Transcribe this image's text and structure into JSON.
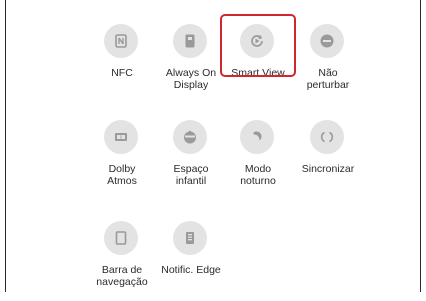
{
  "quick_settings": {
    "rows": [
      [
        {
          "icon": "nfc-icon",
          "label": "NFC"
        },
        {
          "icon": "always-on-display-icon",
          "label": "Always On\nDisplay"
        },
        {
          "icon": "smart-view-icon",
          "label": "Smart View",
          "highlighted": true
        },
        {
          "icon": "do-not-disturb-icon",
          "label": "Não\nperturbar"
        }
      ],
      [
        {
          "icon": "dolby-atmos-icon",
          "label": "Dolby\nAtmos"
        },
        {
          "icon": "kids-space-icon",
          "label": "Espaço\ninfantil"
        },
        {
          "icon": "night-mode-icon",
          "label": "Modo\nnoturno"
        },
        {
          "icon": "sync-icon",
          "label": "Sincronizar"
        }
      ],
      [
        {
          "icon": "navigation-bar-icon",
          "label": "Barra de\nnavegação"
        },
        {
          "icon": "edge-notification-icon",
          "label": "Notific. Edge"
        }
      ]
    ]
  },
  "colors": {
    "icon_circle": "#e3e3e3",
    "icon_glyph": "#9a9a9a",
    "highlight_border": "#d0272f"
  }
}
